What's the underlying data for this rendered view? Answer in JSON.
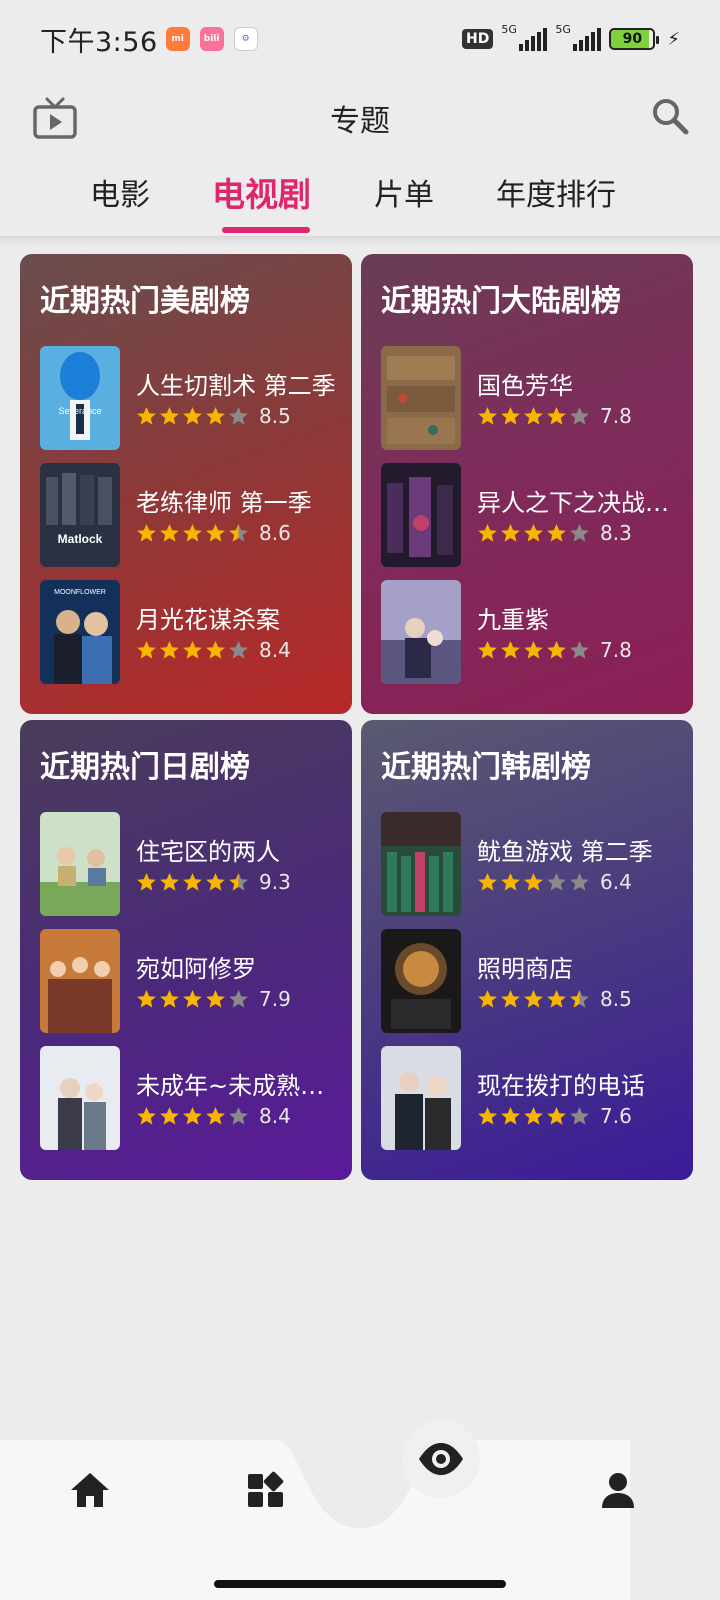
{
  "status_bar": {
    "time": "下午3:56",
    "badges": [
      {
        "name": "mi-store-badge",
        "label": "mi",
        "color": "#ff7a3c"
      },
      {
        "name": "bilibili-badge",
        "label": "bili",
        "color": "#fb7299"
      },
      {
        "name": "app-badge",
        "label": "⚙",
        "color": "#4d6fd8"
      }
    ],
    "hd_label": "HD",
    "signal_label": "5G",
    "battery_level": "90"
  },
  "header": {
    "title": "专题"
  },
  "tabs": [
    {
      "label": "电影",
      "active": false
    },
    {
      "label": "电视剧",
      "active": true
    },
    {
      "label": "片单",
      "active": false
    },
    {
      "label": "年度排行",
      "active": false
    }
  ],
  "cards": [
    {
      "title": "近期热门美剧榜",
      "items": [
        {
          "title": "人生切割术 第二季",
          "rating": 8.5,
          "stars": 4.0
        },
        {
          "title": "老练律师 第一季",
          "rating": 8.6,
          "stars": 4.5
        },
        {
          "title": "月光花谋杀案",
          "rating": 8.4,
          "stars": 4.0
        }
      ]
    },
    {
      "title": "近期热门大陆剧榜",
      "items": [
        {
          "title": "国色芳华",
          "rating": 7.8,
          "stars": 4.0
        },
        {
          "title": "异人之下之决战！碧游村",
          "rating": 8.3,
          "stars": 4.0
        },
        {
          "title": "九重紫",
          "rating": 7.8,
          "stars": 4.0
        }
      ]
    },
    {
      "title": "近期热门日剧榜",
      "items": [
        {
          "title": "住宅区的两人",
          "rating": 9.3,
          "stars": 4.5
        },
        {
          "title": "宛如阿修罗",
          "rating": 7.9,
          "stars": 4.0
        },
        {
          "title": "未成年~未成熟的我们无法成为爱~",
          "rating": 8.4,
          "stars": 4.0
        }
      ]
    },
    {
      "title": "近期热门韩剧榜",
      "items": [
        {
          "title": "鱿鱼游戏 第二季",
          "rating": 6.4,
          "stars": 3.0
        },
        {
          "title": "照明商店",
          "rating": 8.5,
          "stars": 4.5
        },
        {
          "title": "现在拨打的电话",
          "rating": 7.6,
          "stars": 4.0
        }
      ]
    }
  ],
  "colors": {
    "accent": "#e0246e",
    "star": "#f7b500",
    "star_empty": "#8a8a8a"
  },
  "bottom_nav": [
    "home-icon",
    "categories-icon",
    "eye-icon",
    "profile-icon"
  ]
}
